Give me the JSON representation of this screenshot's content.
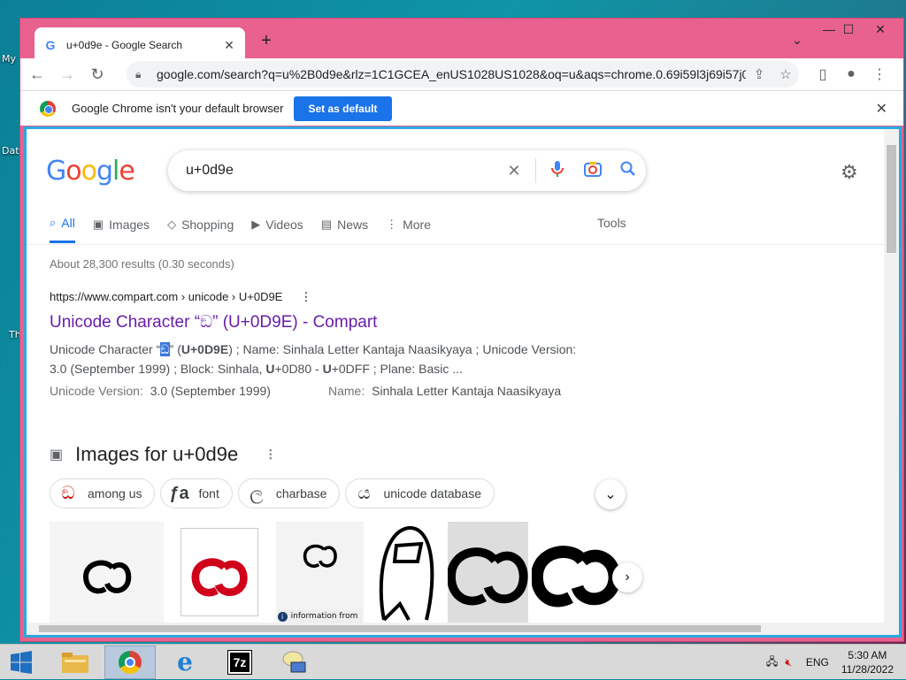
{
  "desktop": {
    "icons": [
      "My",
      "Dat",
      "Th"
    ]
  },
  "browser": {
    "tab_title": "u+0d9e - Google Search",
    "tab_close": "✕",
    "new_tab": "+",
    "url": "google.com/search?q=u%2B0d9e&rlz=1C1GCEA_enUS1028US1028&oq=u&aqs=chrome.0.69i59l3j69i57j0...",
    "infobar_text": "Google Chrome isn't your default browser",
    "set_default": "Set as default",
    "infobar_close": "✕"
  },
  "google": {
    "logo": [
      "G",
      "o",
      "o",
      "g",
      "l",
      "e"
    ],
    "query": "u+0d9e",
    "tabs": [
      {
        "label": "All",
        "icon": "search-icon"
      },
      {
        "label": "Images",
        "icon": "image-icon"
      },
      {
        "label": "Shopping",
        "icon": "tag-icon"
      },
      {
        "label": "Videos",
        "icon": "play-icon"
      },
      {
        "label": "News",
        "icon": "news-icon"
      },
      {
        "label": "More",
        "icon": "kebab-icon"
      }
    ],
    "tools": "Tools",
    "stats": "About 28,300 results (0.30 seconds)"
  },
  "result": {
    "cite": "https://www.compart.com › unicode › U+0D9E",
    "title": "Unicode Character “ඞ” (U+0D9E) - Compart",
    "snippet_a": "Unicode Character “",
    "snippet_glyph": "ඞ",
    "snippet_b": "” (",
    "snippet_bold1": "U+0D9E",
    "snippet_c": ") ; Name: Sinhala Letter Kantaja Naasikyaya ; Unicode Version: 3.0 (September 1999) ; Block: Sinhala, ",
    "snippet_bold2": "U",
    "snippet_d": "+0D80 - ",
    "snippet_bold3": "U",
    "snippet_e": "+0DFF ; Plane: Basic ...",
    "fact1_key": "Unicode Version:",
    "fact1_val": "3.0 (September 1999)",
    "fact2_key": "Name:",
    "fact2_val": "Sinhala Letter Kantaja Naasikyaya"
  },
  "images": {
    "heading": "Images for u+0d9e",
    "chips": [
      {
        "label": "among us",
        "glyph": "ඞ"
      },
      {
        "label": "font",
        "glyph": "ƒa"
      },
      {
        "label": "charbase",
        "glyph": "ල"
      },
      {
        "label": "unicode database",
        "glyph": "ය"
      }
    ],
    "thumb_caption": "information from"
  },
  "taskbar": {
    "lang": "ENG",
    "time": "5:30 AM",
    "date": "11/28/2022"
  },
  "colors": {
    "accent": "#1a73e8",
    "window_frame": "#e8618f",
    "visited_link": "#681da8"
  }
}
